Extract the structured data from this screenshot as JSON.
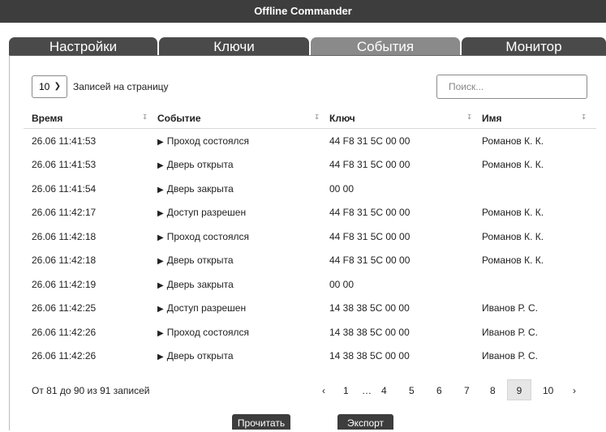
{
  "app": {
    "title": "Offline Commander"
  },
  "tabs": [
    {
      "label": "Настройки"
    },
    {
      "label": "Ключи"
    },
    {
      "label": "События"
    },
    {
      "label": "Монитор"
    }
  ],
  "controls": {
    "page_size_value": "10",
    "page_size_label": "Записей на страницу",
    "search_placeholder": "Поиск..."
  },
  "table": {
    "columns": [
      "Время",
      "Событие",
      "Ключ",
      "Имя"
    ],
    "rows": [
      [
        "26.06 11:41:53",
        "Проход состоялся",
        "44 F8 31 5C 00 00",
        "Романов К. К."
      ],
      [
        "26.06 11:41:53",
        "Дверь открыта",
        "44 F8 31 5C 00 00",
        "Романов К. К."
      ],
      [
        "26.06 11:41:54",
        "Дверь закрыта",
        "00 00",
        ""
      ],
      [
        "26.06 11:42:17",
        "Доступ разрешен",
        "44 F8 31 5C 00 00",
        "Романов К. К."
      ],
      [
        "26.06 11:42:18",
        "Проход состоялся",
        "44 F8 31 5C 00 00",
        "Романов К. К."
      ],
      [
        "26.06 11:42:18",
        "Дверь открыта",
        "44 F8 31 5C 00 00",
        "Романов К. К."
      ],
      [
        "26.06 11:42:19",
        "Дверь закрыта",
        "00 00",
        ""
      ],
      [
        "26.06 11:42:25",
        "Доступ разрешен",
        "14 38 38 5C 00 00",
        "Иванов Р. С."
      ],
      [
        "26.06 11:42:26",
        "Проход состоялся",
        "14 38 38 5C 00 00",
        "Иванов Р. С."
      ],
      [
        "26.06 11:42:26",
        "Дверь открыта",
        "14 38 38 5C 00 00",
        "Иванов Р. С."
      ]
    ]
  },
  "footer": {
    "info": "От 81 до 90 из 91 записей",
    "pagination": {
      "prev": "‹",
      "pages": [
        "1",
        "…",
        "4",
        "5",
        "6",
        "7",
        "8",
        "9",
        "10"
      ],
      "current": "9",
      "next": "›"
    }
  },
  "actions": {
    "read_label": "Прочитать",
    "export_label": "Экспорт"
  },
  "icons": {
    "row_arrow": "play-triangle-icon",
    "sort": "sort-icon",
    "dropdown": "chevron-down-icon"
  },
  "colors": {
    "header_bg": "#3d3d3d",
    "tab_bg": "#4a4a4a",
    "tab_active_bg": "#8a8a8a"
  }
}
